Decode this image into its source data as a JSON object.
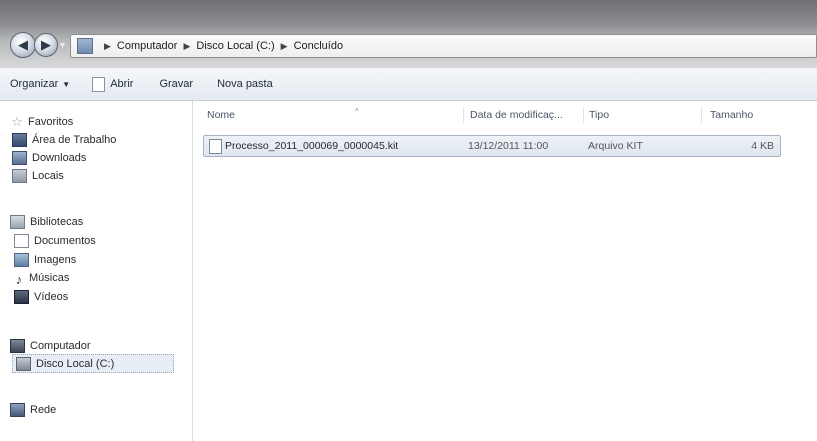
{
  "address_bar": {
    "crumbs": [
      "Computador",
      "Disco Local (C:)",
      "Concluído"
    ]
  },
  "toolbar": {
    "organize_label": "Organizar",
    "open_label": "Abrir",
    "burn_label": "Gravar",
    "new_folder_label": "Nova pasta"
  },
  "navpane": {
    "favorites_label": "Favoritos",
    "favorites_items": [
      "Área de Trabalho",
      "Downloads",
      "Locais"
    ],
    "libraries_label": "Bibliotecas",
    "libraries_items": [
      "Documentos",
      "Imagens",
      "Músicas",
      "Vídeos"
    ],
    "computer_label": "Computador",
    "computer_items": [
      "Disco Local (C:)"
    ],
    "network_label": "Rede"
  },
  "content": {
    "columns": {
      "name": "Nome",
      "date": "Data de modificaç...",
      "type": "Tipo",
      "size": "Tamanho"
    },
    "files": [
      {
        "name": "Processo_2011_000069_0000045.kit",
        "date": "13/12/2011 11:00",
        "type": "Arquivo KIT",
        "size": "4 KB"
      }
    ]
  }
}
